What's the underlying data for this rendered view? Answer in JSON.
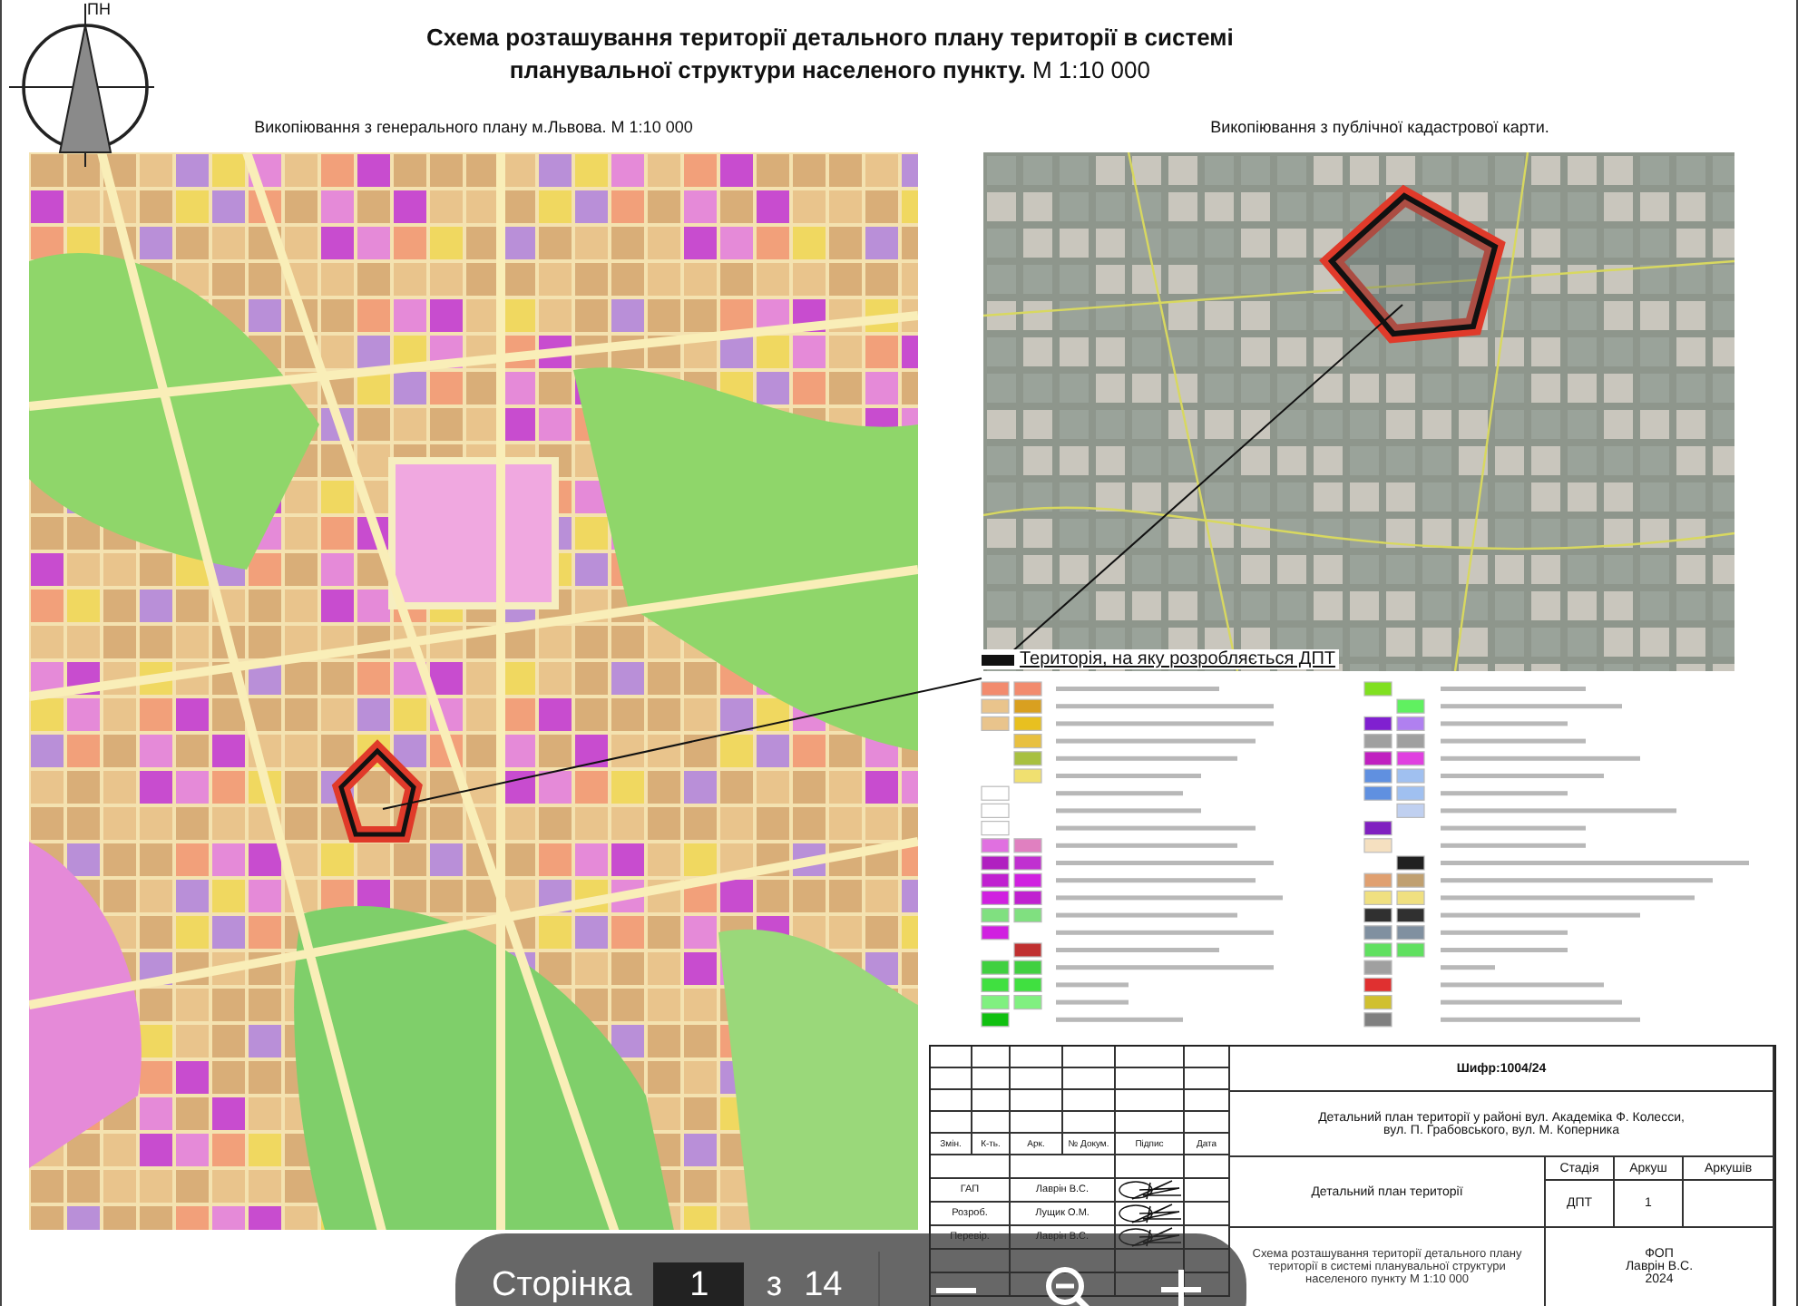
{
  "north_arrow": {
    "label": "ПН"
  },
  "title": {
    "lines": [
      "**Схема розташування території детального плану території в системі**",
      "**планувальної структури населеного пункту.** М 1:10 000"
    ]
  },
  "panels": [
    {
      "kind": "plan_map",
      "caption": "Викопіювання з генерального плану м.Львова. М 1:10 000"
    },
    {
      "kind": "aerial_photo",
      "caption": "Викопіювання з публічної кадастрової карти."
    }
  ],
  "callout": {
    "text": "Територія, на яку розробляється ДПТ"
  },
  "title_block": {
    "code": "Шифр:1004/24",
    "project": "Детальний план території у районі вул. Академіка Ф. Колесси, вул. П. Грабовського, вул. М. Коперника",
    "columns": [
      "Змін.",
      "К-ть.",
      "Арк.",
      "№ Докум.",
      "Підпис",
      "Дата"
    ],
    "signers": [
      {
        "role": "ГАП",
        "name": "Лаврін В.С."
      },
      {
        "role": "Розроб.",
        "name": "Лущик О.М."
      },
      {
        "role": "Перевір.",
        "name": "Лаврін В.С."
      }
    ],
    "document": "Детальний план території",
    "stage_headers": [
      "Стадія",
      "Аркуш",
      "Аркушів"
    ],
    "stage_values": [
      "ДПТ",
      "1"
    ],
    "sheet_title": "Схема розташування території детального плану території в системі планувальної структури населеного пункту М 1:10 000",
    "organization": [
      "ФОП",
      "Лаврін В.С.",
      "2024"
    ]
  },
  "viewer_toolbar": {
    "page_label": "Сторінка",
    "page": "1",
    "of": "з",
    "total": "14"
  }
}
